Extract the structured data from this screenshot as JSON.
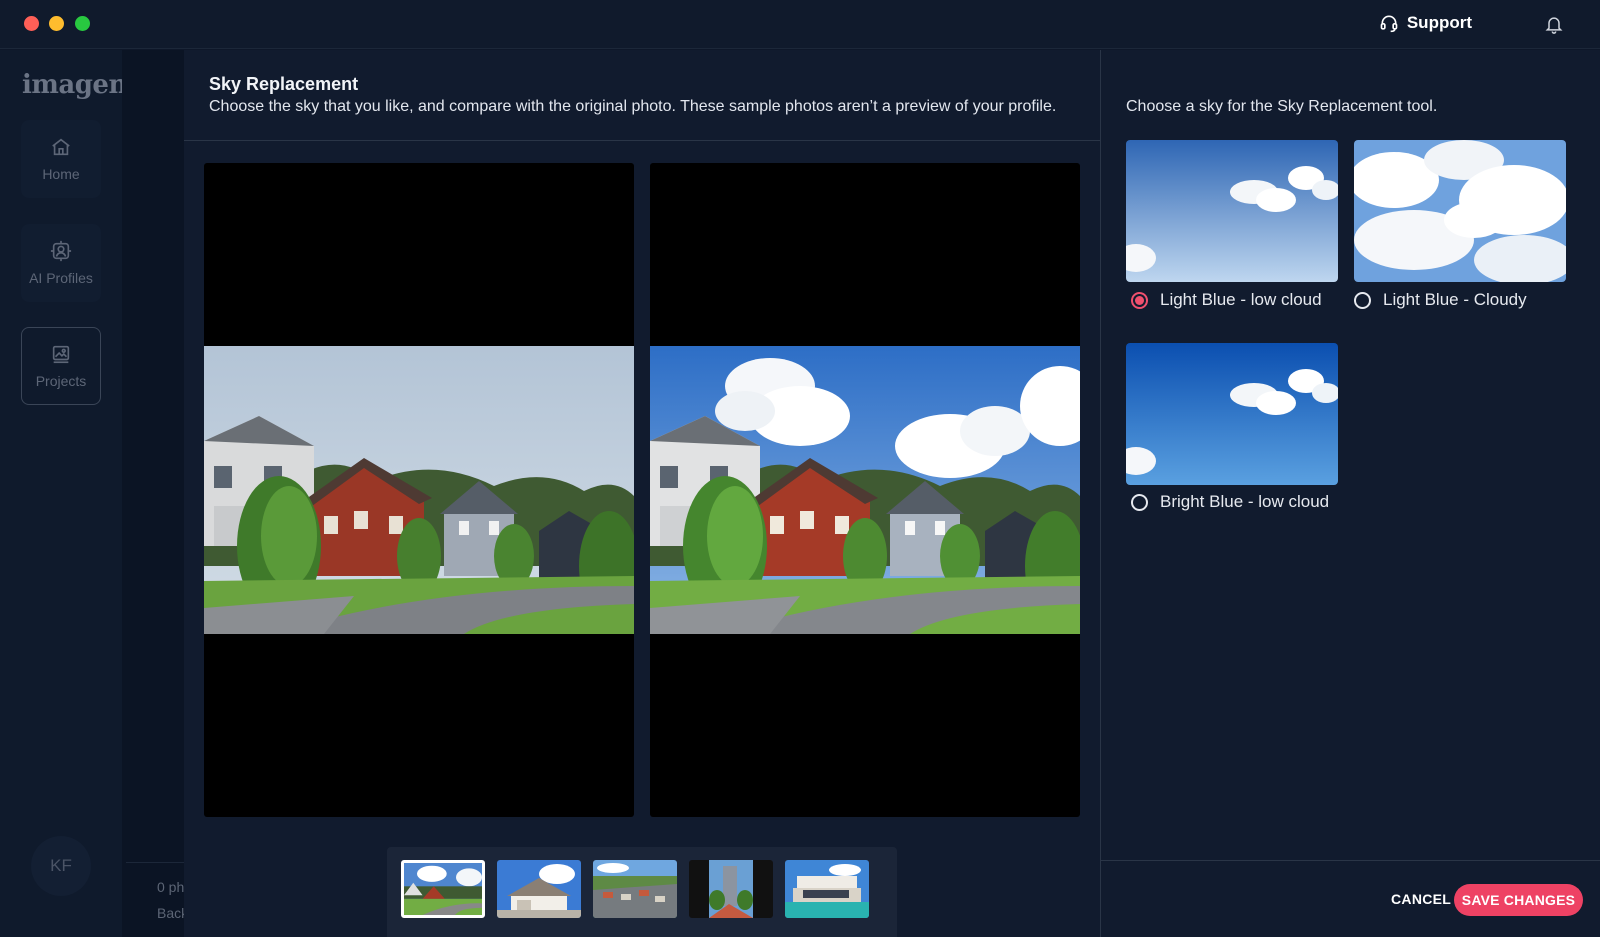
{
  "titlebar": {
    "support_label": "Support"
  },
  "sidebar": {
    "logo": "imagen",
    "items": [
      {
        "label": "Home",
        "icon": "home-icon"
      },
      {
        "label": "AI Profiles",
        "icon": "ai-profile-icon"
      },
      {
        "label": "Projects",
        "icon": "projects-icon",
        "active": true
      }
    ],
    "avatar_initials": "KF"
  },
  "background": {
    "line1": "0 ph",
    "line2": "Back"
  },
  "modal": {
    "title": "Sky Replacement",
    "description": "Choose the sky that you like, and compare with the original photo. These sample photos aren’t a preview of your profile.",
    "thumbnails": [
      {
        "name": "house-street",
        "selected": true
      },
      {
        "name": "white-house",
        "selected": false
      },
      {
        "name": "aerial-neighborhood",
        "selected": false
      },
      {
        "name": "tower-courtyard",
        "selected": false
      },
      {
        "name": "modern-villa-pool",
        "selected": false
      }
    ]
  },
  "panel": {
    "prompt": "Choose a sky for the Sky Replacement tool.",
    "options": [
      {
        "label": "Light Blue - low cloud",
        "selected": true
      },
      {
        "label": "Light Blue - Cloudy",
        "selected": false
      },
      {
        "label": "Bright Blue - low cloud",
        "selected": false
      }
    ],
    "cancel_label": "CANCEL",
    "save_label": "SAVE CHANGES"
  },
  "colors": {
    "accent": "#ee4264",
    "background": "#0e1729",
    "panel": "#111b2e"
  }
}
